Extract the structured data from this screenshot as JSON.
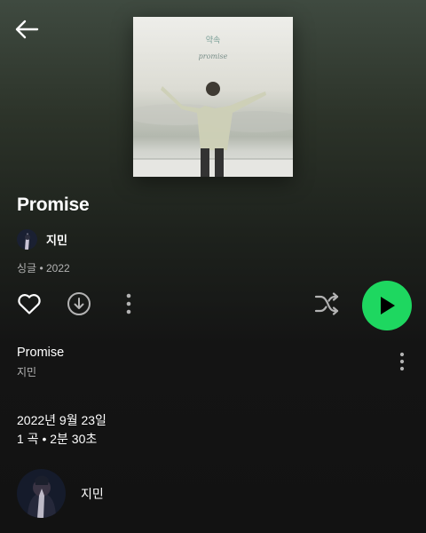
{
  "header": {
    "back_icon": "arrow-left-icon"
  },
  "album": {
    "cover_title_ko": "약속",
    "cover_title_en": "promise",
    "title": "Promise",
    "artist": "지민",
    "type": "싱글",
    "year": "2022"
  },
  "actions": {
    "like_icon": "heart-outline-icon",
    "download_icon": "download-circle-icon",
    "more_icon": "more-vertical-icon",
    "shuffle_icon": "shuffle-icon",
    "play_icon": "play-icon",
    "play_color": "#1ed760"
  },
  "tracks": [
    {
      "title": "Promise",
      "artist": "지민"
    }
  ],
  "release": {
    "date": "2022년 9월 23일",
    "count": "1 곡",
    "duration": "2분 30초"
  },
  "footer": {
    "artist_name": "지민"
  }
}
